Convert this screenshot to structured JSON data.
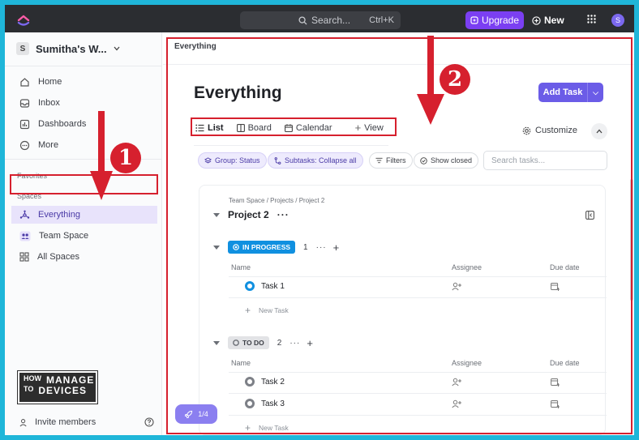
{
  "topbar": {
    "search_label": "Search...",
    "search_shortcut": "Ctrl+K",
    "upgrade_label": "Upgrade",
    "new_label": "New",
    "avatar_initial": "S"
  },
  "sidebar": {
    "workspace_initial": "S",
    "workspace_name": "Sumitha's W...",
    "nav": [
      {
        "label": "Home"
      },
      {
        "label": "Inbox"
      },
      {
        "label": "Dashboards"
      },
      {
        "label": "More"
      }
    ],
    "favorites_header": "Favorites",
    "spaces_header": "Spaces",
    "spaces": [
      {
        "label": "Everything"
      },
      {
        "label": "Team Space"
      },
      {
        "label": "All Spaces"
      }
    ],
    "invite_label": "Invite members"
  },
  "watermark": {
    "line1a": "HOW",
    "line1b": "MANAGE",
    "line2a": "TO",
    "line2b": "DEVICES"
  },
  "main": {
    "breadcrumb": "Everything",
    "title": "Everything",
    "add_task_label": "Add Task",
    "views": [
      {
        "label": "List"
      },
      {
        "label": "Board"
      },
      {
        "label": "Calendar"
      },
      {
        "label": "View"
      }
    ],
    "customize_label": "Customize",
    "chips": {
      "group": "Group: Status",
      "subtasks": "Subtasks: Collapse all",
      "filters": "Filters",
      "show_closed": "Show closed"
    },
    "search_placeholder": "Search tasks...",
    "card": {
      "path": "Team Space / Projects / Project 2",
      "project_name": "Project 2",
      "groups": [
        {
          "status": "IN PROGRESS",
          "count": "1",
          "columns": {
            "name": "Name",
            "assignee": "Assignee",
            "due": "Due date"
          },
          "tasks": [
            {
              "name": "Task 1"
            }
          ],
          "new_task": "New Task"
        },
        {
          "status": "TO DO",
          "count": "2",
          "columns": {
            "name": "Name",
            "assignee": "Assignee",
            "due": "Due date"
          },
          "tasks": [
            {
              "name": "Task 2"
            },
            {
              "name": "Task 3"
            }
          ],
          "new_task": "New Task"
        }
      ]
    }
  },
  "onboarding": {
    "progress": "1/4"
  },
  "annotations": {
    "step1": "1",
    "step2": "2"
  },
  "colors": {
    "accent": "#6b5ce7",
    "in_progress": "#1090e0",
    "highlight": "#d6202e",
    "frame": "#1fb6d9"
  }
}
